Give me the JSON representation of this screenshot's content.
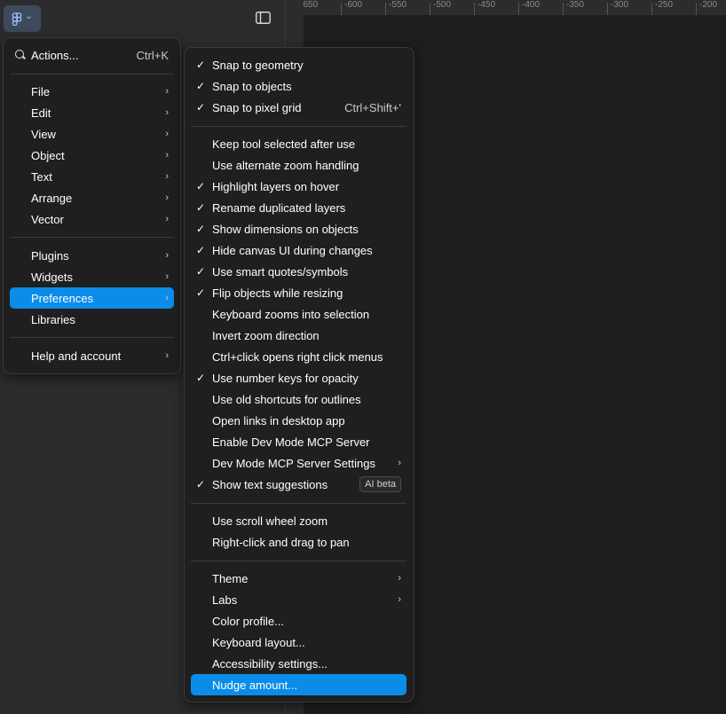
{
  "toolbar": {
    "menu_button_icon": "figma-logo-icon",
    "chevron": "⌄",
    "panel_toggle_icon": "panel-toggle-icon"
  },
  "ruler": {
    "ticks": [
      "-650",
      "-600",
      "-550",
      "-500",
      "-450",
      "-400",
      "-350",
      "-300",
      "-250",
      "-200"
    ]
  },
  "main_menu": {
    "actions": {
      "label": "Actions...",
      "shortcut": "Ctrl+K"
    },
    "items_group1": [
      "File",
      "Edit",
      "View",
      "Object",
      "Text",
      "Arrange",
      "Vector"
    ],
    "items_group2": [
      "Plugins",
      "Widgets",
      "Preferences",
      "Libraries"
    ],
    "help": "Help and account"
  },
  "preferences_menu": {
    "snap": [
      {
        "label": "Snap to geometry",
        "checked": true
      },
      {
        "label": "Snap to objects",
        "checked": true
      },
      {
        "label": "Snap to pixel grid",
        "checked": true,
        "shortcut": "Ctrl+Shift+'"
      }
    ],
    "options": [
      {
        "label": "Keep tool selected after use",
        "checked": false
      },
      {
        "label": "Use alternate zoom handling",
        "checked": false
      },
      {
        "label": "Highlight layers on hover",
        "checked": true
      },
      {
        "label": "Rename duplicated layers",
        "checked": true
      },
      {
        "label": "Show dimensions on objects",
        "checked": true
      },
      {
        "label": "Hide canvas UI during changes",
        "checked": true
      },
      {
        "label": "Use smart quotes/symbols",
        "checked": true
      },
      {
        "label": "Flip objects while resizing",
        "checked": true
      },
      {
        "label": "Keyboard zooms into selection",
        "checked": false
      },
      {
        "label": "Invert zoom direction",
        "checked": false
      },
      {
        "label": "Ctrl+click opens right click menus",
        "checked": false
      },
      {
        "label": "Use number keys for opacity",
        "checked": true
      },
      {
        "label": "Use old shortcuts for outlines",
        "checked": false
      },
      {
        "label": "Open links in desktop app",
        "checked": false
      },
      {
        "label": "Enable Dev Mode MCP Server",
        "checked": false
      },
      {
        "label": "Dev Mode MCP Server Settings",
        "checked": false
      },
      {
        "label": "Show text suggestions",
        "checked": true,
        "badge": "AI beta"
      }
    ],
    "scroll": [
      {
        "label": "Use scroll wheel zoom"
      },
      {
        "label": "Right-click and drag to pan"
      }
    ],
    "misc": [
      {
        "label": "Theme"
      },
      {
        "label": "Labs"
      },
      {
        "label": "Color profile..."
      },
      {
        "label": "Keyboard layout..."
      },
      {
        "label": "Accessibility settings..."
      },
      {
        "label": "Nudge amount..."
      }
    ],
    "check_glyph": "✓",
    "arrow_glyph": "›"
  },
  "colors": {
    "highlight": "#0c8ce9",
    "menu_bg": "#1f1f1f",
    "canvas_bg": "#1e1e1e",
    "panel_bg": "#2c2c2c"
  }
}
